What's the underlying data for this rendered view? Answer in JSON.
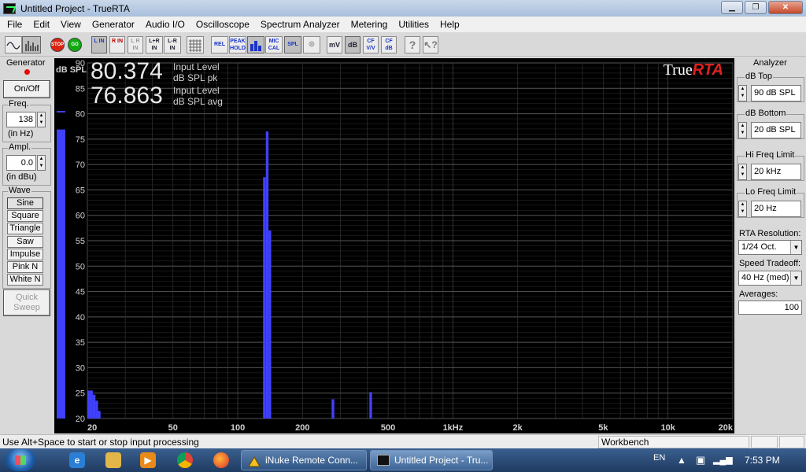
{
  "window": {
    "title": "Untitled Project - TrueRTA",
    "buttons": {
      "minimize": "▁",
      "maximize": "❐",
      "close": "✕"
    }
  },
  "menu": [
    "File",
    "Edit",
    "View",
    "Generator",
    "Audio I/O",
    "Oscilloscope",
    "Spectrum Analyzer",
    "Metering",
    "Utilities",
    "Help"
  ],
  "toolbar": {
    "stop": "STOP",
    "go": "GO",
    "l_in": "L IN",
    "r_in": "R IN",
    "lr_in": "L R IN",
    "lplusr_in": "L+R IN",
    "lminusr_in": "L-R IN",
    "rel": "REL",
    "peak_hold": "PEAK HOLD",
    "mic_cal": "MIC CAL",
    "spl": "SPL",
    "mv": "mV",
    "db": "dB",
    "cf_vv": "CF V/V",
    "cf_db": "CF dB"
  },
  "generator": {
    "title": "Generator",
    "on_off": "On/Off",
    "freq_label": "Freq.",
    "freq_value": "138",
    "freq_unit": "(in Hz)",
    "ampl_label": "Ampl.",
    "ampl_value": "0.0",
    "ampl_unit": "(in dBu)",
    "wave_label": "Wave",
    "waves": [
      "Sine",
      "Square",
      "Triangle",
      "Saw",
      "Impulse",
      "Pink N",
      "White N"
    ],
    "quick_sweep": "Quick Sweep"
  },
  "graph": {
    "brand_true": "True",
    "brand_rta": "RTA",
    "pk_value": "80.374",
    "pk_label1": "Input Level",
    "pk_label2": "dB SPL pk",
    "avg_value": "76.863",
    "avg_label1": "Input Level",
    "avg_label2": "dB SPL avg",
    "colors": {
      "bar": "#4040ff",
      "grid": "#3a3a3a",
      "background": "#000000"
    }
  },
  "chart_data": {
    "type": "bar",
    "title": "",
    "ylabel": "dB SPL",
    "xlabel": "",
    "ylim": [
      20,
      90
    ],
    "xlim_hz": [
      20,
      20000
    ],
    "xscale": "log",
    "y_ticks": [
      90,
      85,
      80,
      75,
      70,
      65,
      60,
      55,
      50,
      45,
      40,
      35,
      30,
      25,
      20
    ],
    "x_ticks": [
      {
        "label": "20",
        "hz": 20
      },
      {
        "label": "50",
        "hz": 50
      },
      {
        "label": "100",
        "hz": 100
      },
      {
        "label": "200",
        "hz": 200
      },
      {
        "label": "500",
        "hz": 500
      },
      {
        "label": "1kHz",
        "hz": 1000
      },
      {
        "label": "2k",
        "hz": 2000
      },
      {
        "label": "5k",
        "hz": 5000
      },
      {
        "label": "10k",
        "hz": 10000
      },
      {
        "label": "20k",
        "hz": 20000
      }
    ],
    "level_meter": {
      "avg": 76.9,
      "peak": 80.4
    },
    "bars": [
      {
        "hz": 20.3,
        "db": 25.5
      },
      {
        "hz": 20.9,
        "db": 25.5
      },
      {
        "hz": 21.5,
        "db": 24.7
      },
      {
        "hz": 22.1,
        "db": 23.5
      },
      {
        "hz": 22.7,
        "db": 21.5
      },
      {
        "hz": 133,
        "db": 67.5
      },
      {
        "hz": 137,
        "db": 76.5
      },
      {
        "hz": 141,
        "db": 57.0
      },
      {
        "hz": 277,
        "db": 23.8
      },
      {
        "hz": 415,
        "db": 25.2
      }
    ]
  },
  "analyzer": {
    "title": "Analyzer",
    "db_top_label": "dB Top",
    "db_top_value": "90 dB SPL",
    "db_bottom_label": "dB Bottom",
    "db_bottom_value": "20 dB SPL",
    "hi_freq_label": "Hi Freq Limit",
    "hi_freq_value": "20 kHz",
    "lo_freq_label": "Lo Freq Limit",
    "lo_freq_value": "20 Hz",
    "resolution_label": "RTA Resolution:",
    "resolution_value": "1/24 Oct.",
    "speed_label": "Speed Tradeoff:",
    "speed_value": "40 Hz (med)",
    "averages_label": "Averages:",
    "averages_value": "100"
  },
  "status": {
    "message": "Use Alt+Space to start or stop input processing",
    "mode": "Workbench"
  },
  "taskbar": {
    "tasks": [
      "iNuke Remote Conn...",
      "Untitled Project - Tru..."
    ],
    "language": "EN",
    "time": "7:53 PM"
  }
}
